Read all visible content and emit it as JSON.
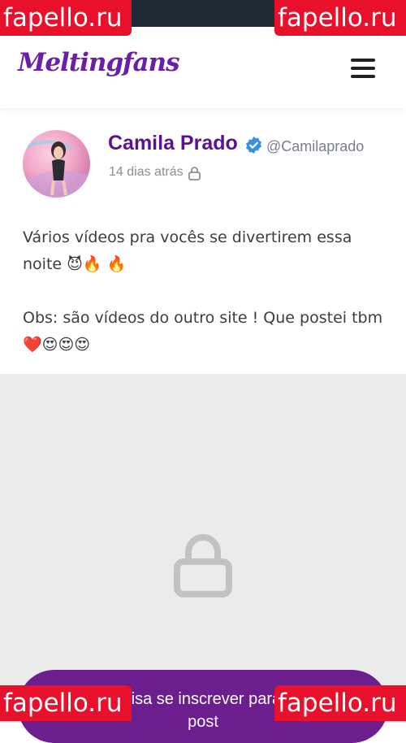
{
  "watermark": {
    "text": "fapello.ru"
  },
  "header": {
    "logo_text": "Meltingfans",
    "menu_icon": "hamburger-menu-icon"
  },
  "post": {
    "author_name": "Camila Prado",
    "author_handle": "@Camilaprado",
    "time": "14 dias atrás",
    "lines": [
      "Vários vídeos pra vocês se divertirem essa noite 😈🔥 🔥",
      "Obs: são vídeos do outro site ! Que postei tbm ❤️😍😍😍"
    ]
  },
  "locked": {
    "button_label": "Você precisa se inscrever para ver esse post"
  },
  "colors": {
    "brand": "#6a1fa8",
    "author_name": "#5b1291",
    "button": "#6c1d8e",
    "verified": "#3b8fe0",
    "watermark": "#e8102a"
  }
}
